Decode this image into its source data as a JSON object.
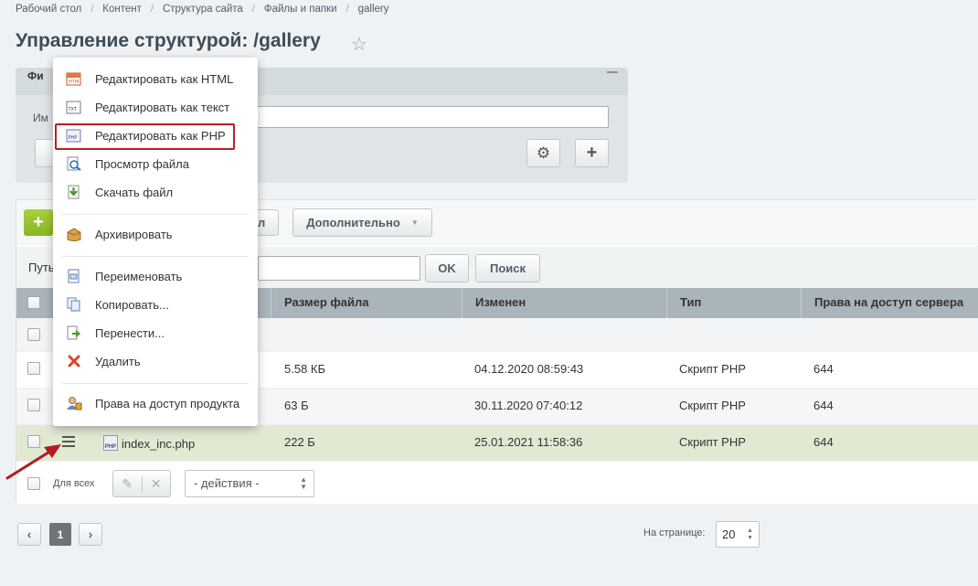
{
  "breadcrumb": [
    "Рабочий стол",
    "Контент",
    "Структура сайта",
    "Файлы и папки",
    "gallery"
  ],
  "page_title": "Управление структурой: /gallery",
  "filter": {
    "tab_label": "Фи",
    "field_label": "Им",
    "name_value": ""
  },
  "toolbar": {
    "add_label": "+",
    "hidden_btn_label": "л",
    "more_label": "Дополнительно"
  },
  "path": {
    "label": "Путь",
    "value": "",
    "ok_label": "OK",
    "search_label": "Поиск"
  },
  "table": {
    "columns": [
      "Размер файла",
      "Изменен",
      "Тип",
      "Права на доступ сервера"
    ],
    "rows": [
      {
        "name": "",
        "size": "",
        "modified": "",
        "type": "",
        "rights": ""
      },
      {
        "name": "",
        "size": "5.58 КБ",
        "modified": "04.12.2020 08:59:43",
        "type": "Скрипт PHP",
        "rights": "644"
      },
      {
        "name": "",
        "size": "63 Б",
        "modified": "30.11.2020 07:40:12",
        "type": "Скрипт PHP",
        "rights": "644"
      },
      {
        "name": "index_inc.php",
        "size": "222 Б",
        "modified": "25.01.2021 11:58:36",
        "type": "Скрипт PHP",
        "rights": "644"
      }
    ],
    "highlighted_row_color": "#e1e9d2"
  },
  "footer": {
    "for_all_label": "Для всех",
    "actions_value": "- действия -"
  },
  "pager": {
    "prev": "‹",
    "current": "1",
    "next": "›",
    "per_page_label": "На странице:",
    "per_page_value": "20"
  },
  "context_menu": {
    "items": [
      {
        "label": "Редактировать как HTML",
        "icon": "html-file-icon"
      },
      {
        "label": "Редактировать как текст",
        "icon": "txt-file-icon"
      },
      {
        "label": "Редактировать как PHP",
        "icon": "php-file-icon",
        "highlighted": true
      },
      {
        "label": "Просмотр файла",
        "icon": "magnifier-file-icon"
      },
      {
        "label": "Скачать файл",
        "icon": "download-icon"
      },
      {
        "label": "Архивировать",
        "icon": "archive-box-icon"
      },
      {
        "label": "Переименовать",
        "icon": "rename-icon"
      },
      {
        "label": "Копировать...",
        "icon": "copy-icon"
      },
      {
        "label": "Перенести...",
        "icon": "move-icon"
      },
      {
        "label": "Удалить",
        "icon": "delete-x-icon"
      },
      {
        "label": "Права на доступ продукта",
        "icon": "user-rights-icon"
      }
    ]
  },
  "file_badge": "PHP",
  "colors": {
    "accent_green": "#8fbc24",
    "highlight_border": "#b52025",
    "annotation_arrow": "#b01c22",
    "header_bg": "#aab4bb"
  }
}
